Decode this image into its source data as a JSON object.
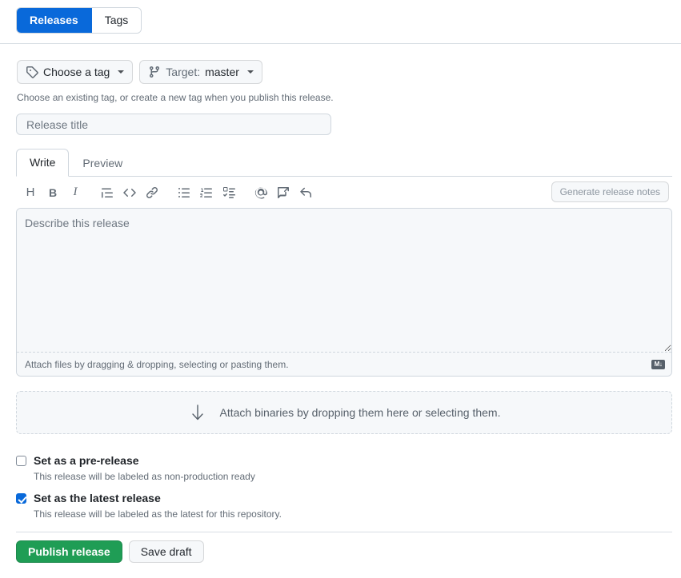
{
  "colors": {
    "accent_blue": "#0969da",
    "success_green": "#1f9d55",
    "border": "#d0d7de",
    "muted_text": "#636c76",
    "field_bg": "#f6f8fa"
  },
  "segmented_nav": {
    "items": [
      {
        "label": "Releases",
        "active": true
      },
      {
        "label": "Tags",
        "active": false
      }
    ]
  },
  "tag_row": {
    "tag_button": {
      "label": "Choose a tag",
      "icon": "tag-icon"
    },
    "target_button": {
      "prefix": "Target:",
      "value": "master",
      "icon": "git-branch-icon"
    },
    "hint": "Choose an existing tag, or create a new tag when you publish this release."
  },
  "release_title": {
    "placeholder": "Release title",
    "value": ""
  },
  "editor": {
    "tabs": [
      {
        "label": "Write",
        "selected": true
      },
      {
        "label": "Preview",
        "selected": false
      }
    ],
    "toolbar": [
      {
        "name": "heading-icon",
        "glyph": "H"
      },
      {
        "name": "bold-icon",
        "glyph": "B"
      },
      {
        "name": "italic-icon",
        "glyph": "I"
      },
      {
        "name": "quote-icon",
        "glyph": "quote"
      },
      {
        "name": "code-icon",
        "glyph": "<>"
      },
      {
        "name": "link-icon",
        "glyph": "link"
      },
      {
        "name": "unordered-list-icon",
        "glyph": "ul"
      },
      {
        "name": "ordered-list-icon",
        "glyph": "ol"
      },
      {
        "name": "task-list-icon",
        "glyph": "tasklist"
      },
      {
        "name": "mention-icon",
        "glyph": "@"
      },
      {
        "name": "saved-reply-icon",
        "glyph": "reply-box"
      },
      {
        "name": "reference-icon",
        "glyph": "reply-arrow"
      }
    ],
    "generate_notes_label": "Generate release notes",
    "generate_notes_disabled": true,
    "body_placeholder": "Describe this release",
    "body_value": "",
    "attach_files_hint": "Attach files by dragging & dropping, selecting or pasting them.",
    "markdown_badge": "M↓"
  },
  "binaries_dropzone": {
    "icon": "download-arrow-icon",
    "label": "Attach binaries by dropping them here or selecting them."
  },
  "options": [
    {
      "label": "Set as a pre-release",
      "note": "This release will be labeled as non-production ready",
      "checked": false
    },
    {
      "label": "Set as the latest release",
      "note": "This release will be labeled as the latest for this repository.",
      "checked": true
    }
  ],
  "footer": {
    "publish_label": "Publish release",
    "save_draft_label": "Save draft"
  }
}
